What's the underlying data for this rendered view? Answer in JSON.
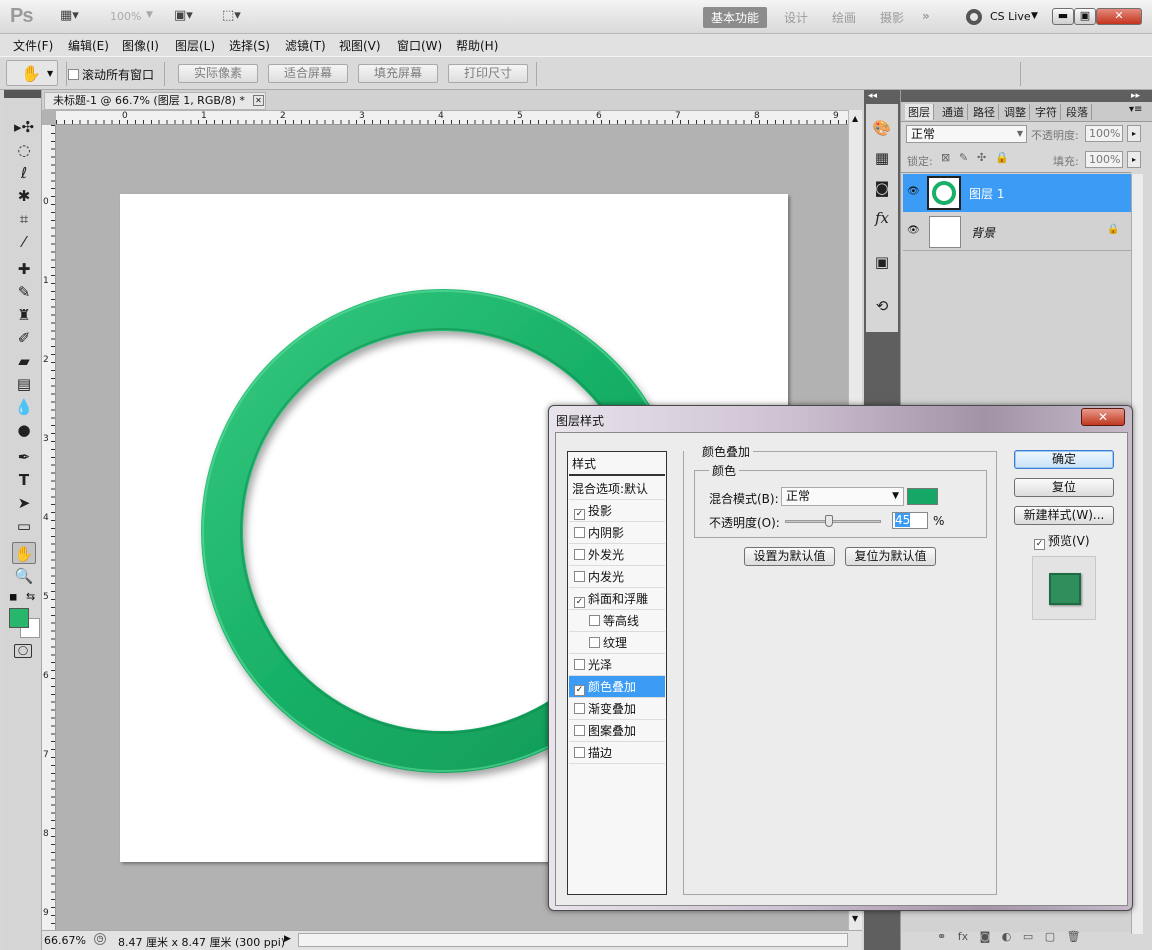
{
  "app": {
    "logo": "Ps",
    "zoom": "100%"
  },
  "workspaces": {
    "basic": "基本功能",
    "design": "设计",
    "paint": "绘画",
    "photo": "摄影",
    "more": "»",
    "cslive": "CS Live"
  },
  "menu": [
    "文件(F)",
    "编辑(E)",
    "图像(I)",
    "图层(L)",
    "选择(S)",
    "滤镜(T)",
    "视图(V)",
    "窗口(W)",
    "帮助(H)"
  ],
  "options": {
    "scroll_all": "滚动所有窗口",
    "actual_pixels": "实际像素",
    "fit_screen": "适合屏幕",
    "fill_screen": "填充屏幕",
    "print_size": "打印尺寸"
  },
  "document": {
    "tab_title": "未标题-1 @ 66.7% (图层 1, RGB/8) *",
    "ruler_h": [
      "0",
      "1",
      "2",
      "3",
      "4",
      "5",
      "6",
      "7",
      "8",
      "9"
    ],
    "ruler_v": [
      "0",
      "1",
      "2",
      "3",
      "4",
      "5",
      "6",
      "7",
      "8",
      "9"
    ]
  },
  "status": {
    "zoom": "66.67%",
    "size": "8.47 厘米 x 8.47 厘米 (300 ppi)"
  },
  "layers_panel": {
    "tabs": [
      "图层",
      "通道",
      "路径",
      "调整",
      "字符",
      "段落"
    ],
    "blend_mode": "正常",
    "opacity_label": "不透明度:",
    "opacity": "100%",
    "lock_label": "锁定:",
    "fill_label": "填充:",
    "fill": "100%",
    "layers": [
      {
        "name": "图层 1",
        "selected": true
      },
      {
        "name": "背景",
        "selected": false
      }
    ]
  },
  "dialog": {
    "title": "图层样式",
    "styles_header": "样式",
    "blend_options": "混合选项:默认",
    "styles": [
      {
        "label": "投影",
        "checked": true,
        "indent": false
      },
      {
        "label": "内阴影",
        "checked": false,
        "indent": false
      },
      {
        "label": "外发光",
        "checked": false,
        "indent": false
      },
      {
        "label": "内发光",
        "checked": false,
        "indent": false
      },
      {
        "label": "斜面和浮雕",
        "checked": true,
        "indent": false
      },
      {
        "label": "等高线",
        "checked": false,
        "indent": true
      },
      {
        "label": "纹理",
        "checked": false,
        "indent": true
      },
      {
        "label": "光泽",
        "checked": false,
        "indent": false
      },
      {
        "label": "颜色叠加",
        "checked": true,
        "indent": false,
        "selected": true
      },
      {
        "label": "渐变叠加",
        "checked": false,
        "indent": false
      },
      {
        "label": "图案叠加",
        "checked": false,
        "indent": false
      },
      {
        "label": "描边",
        "checked": false,
        "indent": false
      }
    ],
    "section_title": "颜色叠加",
    "group_title": "颜色",
    "blend_mode_label": "混合模式(B):",
    "blend_mode_value": "正常",
    "overlay_color": "#14a765",
    "opacity_label": "不透明度(O):",
    "opacity_value": "45",
    "opacity_unit": "%",
    "set_default": "设置为默认值",
    "reset_default": "复位为默认值",
    "ok": "确定",
    "reset": "复位",
    "new_style": "新建样式(W)...",
    "preview_label": "预览(V)"
  },
  "colors": {
    "ring": "#18b066",
    "foreground": "#27b66b",
    "selection": "#3c9cf5"
  }
}
